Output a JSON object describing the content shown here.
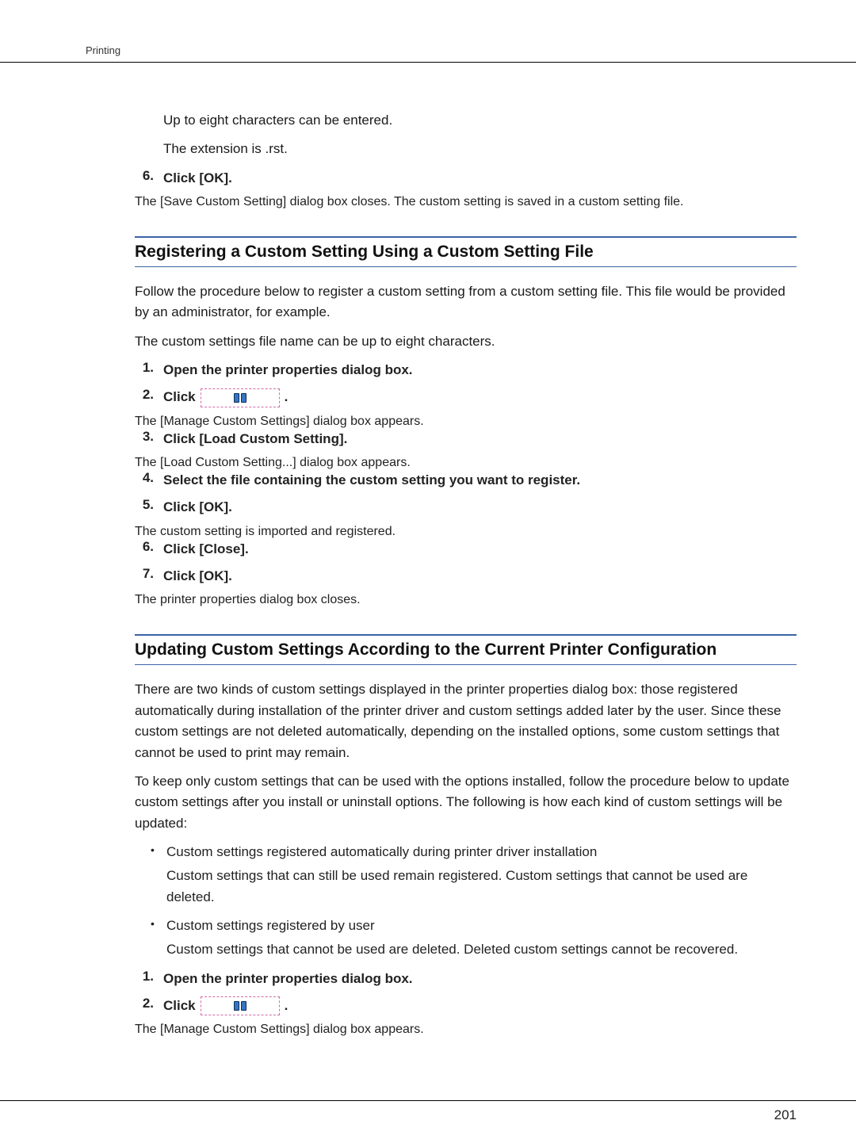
{
  "header": {
    "section_label": "Printing"
  },
  "intro": {
    "line1": "Up to eight characters can be entered.",
    "line2": "The extension is .rst."
  },
  "intro_step": {
    "num": "6.",
    "label": "Click [OK].",
    "sub": "The [Save Custom Setting] dialog box closes. The custom setting is saved in a custom setting file."
  },
  "section1": {
    "title": "Registering a Custom Setting Using a Custom Setting File",
    "para1": "Follow the procedure below to register a custom setting from a custom setting file. This file would be provided by an administrator, for example.",
    "para2": "The custom settings file name can be up to eight characters.",
    "steps": [
      {
        "num": "1.",
        "label": "Open the printer properties dialog box.",
        "sub": ""
      },
      {
        "num": "2.",
        "label": "Click",
        "trailing": ".",
        "sub": "The [Manage Custom Settings] dialog box appears.",
        "has_icon": true
      },
      {
        "num": "3.",
        "label": "Click [Load Custom Setting].",
        "sub": "The [Load Custom Setting...] dialog box appears."
      },
      {
        "num": "4.",
        "label": "Select the file containing the custom setting you want to register.",
        "sub": ""
      },
      {
        "num": "5.",
        "label": "Click [OK].",
        "sub": "The custom setting is imported and registered."
      },
      {
        "num": "6.",
        "label": "Click [Close].",
        "sub": ""
      },
      {
        "num": "7.",
        "label": "Click [OK].",
        "sub": "The printer properties dialog box closes."
      }
    ]
  },
  "section2": {
    "title": "Updating Custom Settings According to the Current Printer Configuration",
    "para1": "There are two kinds of custom settings displayed in the printer properties dialog box: those registered automatically during installation of the printer driver and custom settings added later by the user. Since these custom settings are not deleted automatically, depending on the installed options, some custom settings that cannot be used to print may remain.",
    "para2": "To keep only custom settings that can be used with the options installed, follow the procedure below to update custom settings after you install or uninstall options. The following is how each kind of custom settings will be updated:",
    "bullets": [
      {
        "label": "Custom settings registered automatically during printer driver installation",
        "sub": "Custom settings that can still be used remain registered. Custom settings that cannot be used are deleted."
      },
      {
        "label": "Custom settings registered by user",
        "sub": "Custom settings that cannot be used are deleted. Deleted custom settings cannot be recovered."
      }
    ],
    "steps": [
      {
        "num": "1.",
        "label": "Open the printer properties dialog box.",
        "sub": ""
      },
      {
        "num": "2.",
        "label": "Click",
        "trailing": ".",
        "sub": "The [Manage Custom Settings] dialog box appears.",
        "has_icon": true
      }
    ]
  },
  "page_number": "201",
  "icons": {
    "manage_settings": "manage-custom-settings-icon"
  }
}
